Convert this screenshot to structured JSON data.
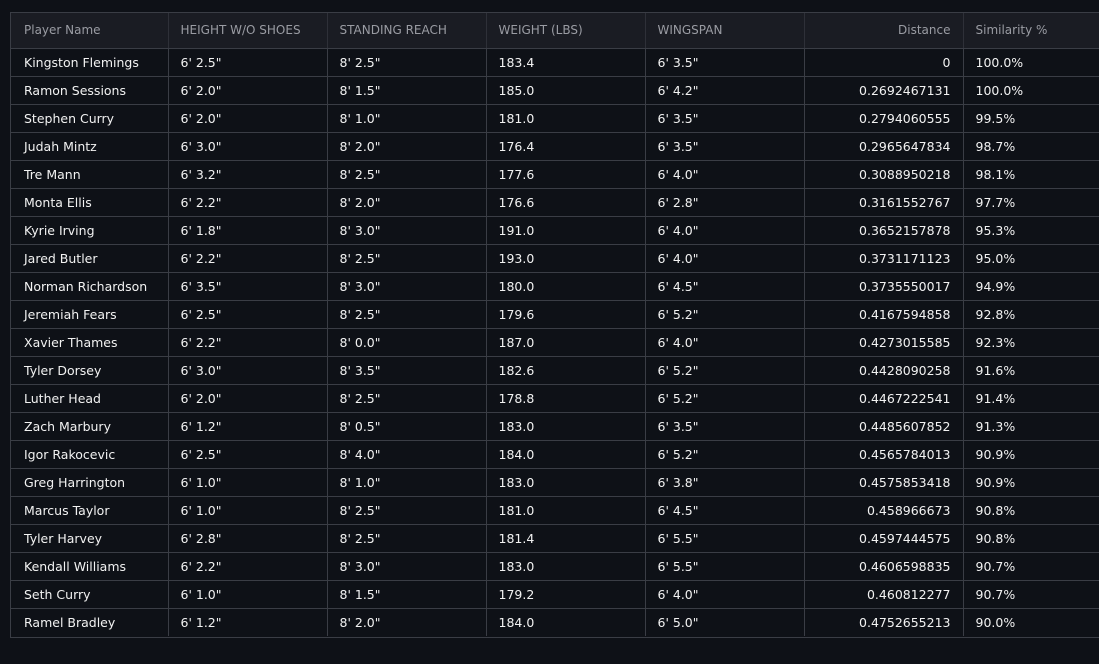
{
  "table": {
    "headers": [
      "Player Name",
      "HEIGHT W/O SHOES",
      "STANDING REACH",
      "WEIGHT (LBS)",
      "WINGSPAN",
      "Distance",
      "Similarity %"
    ],
    "rows": [
      [
        "Kingston Flemings",
        "6' 2.5\"",
        "8' 2.5\"",
        "183.4",
        "6' 3.5\"",
        "0",
        "100.0%"
      ],
      [
        "Ramon Sessions",
        "6' 2.0\"",
        "8' 1.5\"",
        "185.0",
        "6' 4.2\"",
        "0.2692467131",
        "100.0%"
      ],
      [
        "Stephen Curry",
        "6' 2.0\"",
        "8' 1.0\"",
        "181.0",
        "6' 3.5\"",
        "0.2794060555",
        "99.5%"
      ],
      [
        "Judah Mintz",
        "6' 3.0\"",
        "8' 2.0\"",
        "176.4",
        "6' 3.5\"",
        "0.2965647834",
        "98.7%"
      ],
      [
        "Tre Mann",
        "6' 3.2\"",
        "8' 2.5\"",
        "177.6",
        "6' 4.0\"",
        "0.3088950218",
        "98.1%"
      ],
      [
        "Monta Ellis",
        "6' 2.2\"",
        "8' 2.0\"",
        "176.6",
        "6' 2.8\"",
        "0.3161552767",
        "97.7%"
      ],
      [
        "Kyrie Irving",
        "6' 1.8\"",
        "8' 3.0\"",
        "191.0",
        "6' 4.0\"",
        "0.3652157878",
        "95.3%"
      ],
      [
        "Jared Butler",
        "6' 2.2\"",
        "8' 2.5\"",
        "193.0",
        "6' 4.0\"",
        "0.3731171123",
        "95.0%"
      ],
      [
        "Norman Richardson",
        "6' 3.5\"",
        "8' 3.0\"",
        "180.0",
        "6' 4.5\"",
        "0.3735550017",
        "94.9%"
      ],
      [
        "Jeremiah Fears",
        "6' 2.5\"",
        "8' 2.5\"",
        "179.6",
        "6' 5.2\"",
        "0.4167594858",
        "92.8%"
      ],
      [
        "Xavier Thames",
        "6' 2.2\"",
        "8' 0.0\"",
        "187.0",
        "6' 4.0\"",
        "0.4273015585",
        "92.3%"
      ],
      [
        "Tyler Dorsey",
        "6' 3.0\"",
        "8' 3.5\"",
        "182.6",
        "6' 5.2\"",
        "0.4428090258",
        "91.6%"
      ],
      [
        "Luther Head",
        "6' 2.0\"",
        "8' 2.5\"",
        "178.8",
        "6' 5.2\"",
        "0.4467222541",
        "91.4%"
      ],
      [
        "Zach Marbury",
        "6' 1.2\"",
        "8' 0.5\"",
        "183.0",
        "6' 3.5\"",
        "0.4485607852",
        "91.3%"
      ],
      [
        "Igor Rakocevic",
        "6' 2.5\"",
        "8' 4.0\"",
        "184.0",
        "6' 5.2\"",
        "0.4565784013",
        "90.9%"
      ],
      [
        "Greg Harrington",
        "6' 1.0\"",
        "8' 1.0\"",
        "183.0",
        "6' 3.8\"",
        "0.4575853418",
        "90.9%"
      ],
      [
        "Marcus Taylor",
        "6' 1.0\"",
        "8' 2.5\"",
        "181.0",
        "6' 4.5\"",
        "0.458966673",
        "90.8%"
      ],
      [
        "Tyler Harvey",
        "6' 2.8\"",
        "8' 2.5\"",
        "181.4",
        "6' 5.5\"",
        "0.4597444575",
        "90.8%"
      ],
      [
        "Kendall Williams",
        "6' 2.2\"",
        "8' 3.0\"",
        "183.0",
        "6' 5.5\"",
        "0.4606598835",
        "90.7%"
      ],
      [
        "Seth Curry",
        "6' 1.0\"",
        "8' 1.5\"",
        "179.2",
        "6' 4.0\"",
        "0.460812277",
        "90.7%"
      ],
      [
        "Ramel Bradley",
        "6' 1.2\"",
        "8' 2.0\"",
        "184.0",
        "6' 5.0\"",
        "0.4752655213",
        "90.0%"
      ]
    ]
  }
}
